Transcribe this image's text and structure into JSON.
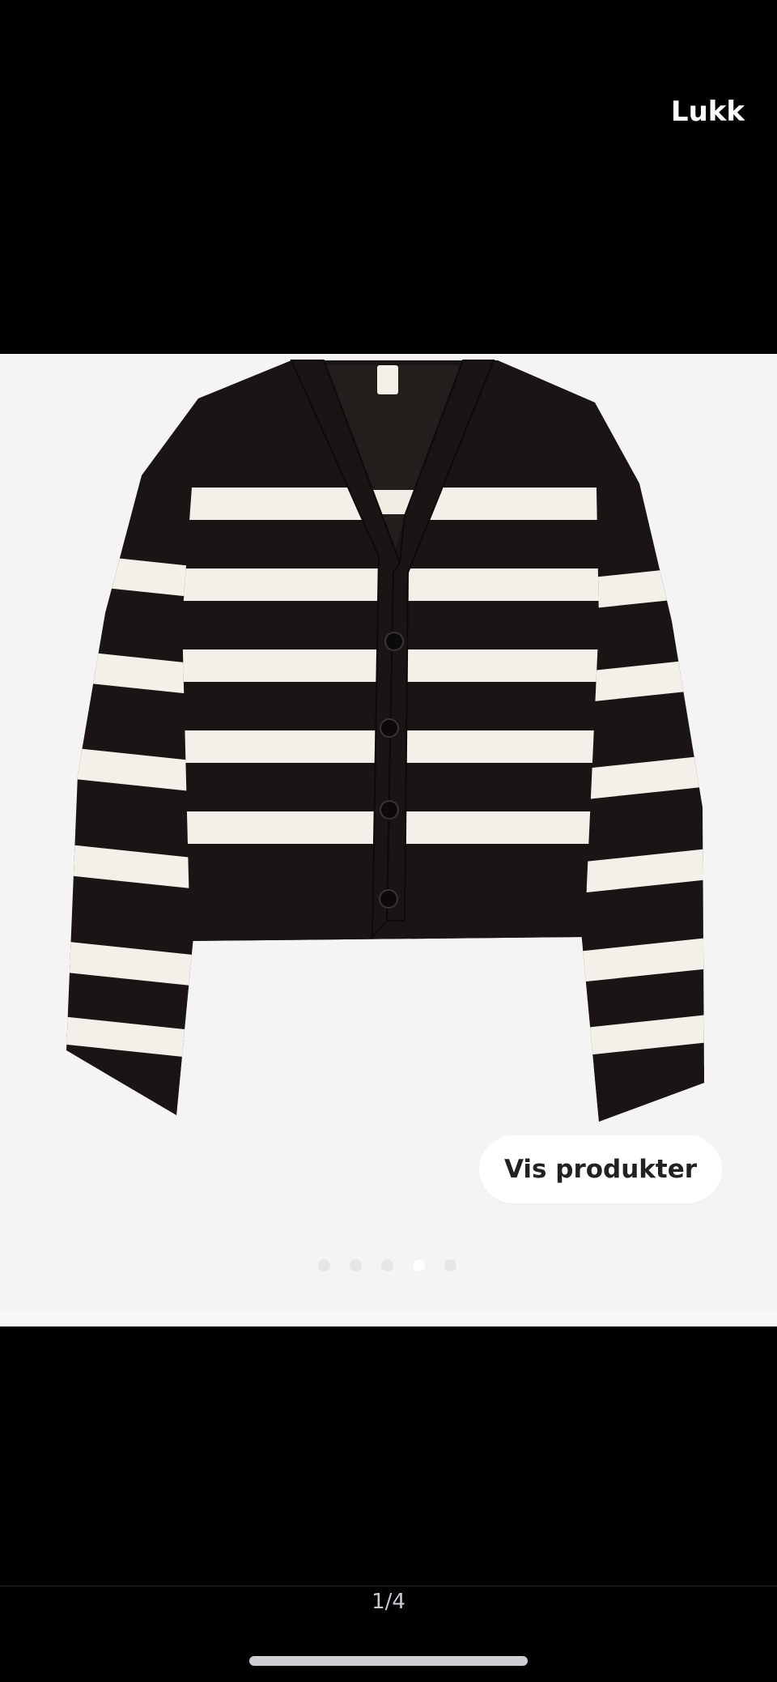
{
  "header": {
    "close_label": "Lukk"
  },
  "gallery": {
    "image_subject": "striped knit cardigan (black and white)",
    "show_products_label": "Vis produkter",
    "dots_count": 5,
    "active_dot_index": 3
  },
  "footer": {
    "counter": "1/4"
  },
  "colors": {
    "background": "#000000",
    "viewer_background": "#f4f4f4",
    "sweater_dark": "#1a1514",
    "sweater_light": "#f3f0e9"
  }
}
